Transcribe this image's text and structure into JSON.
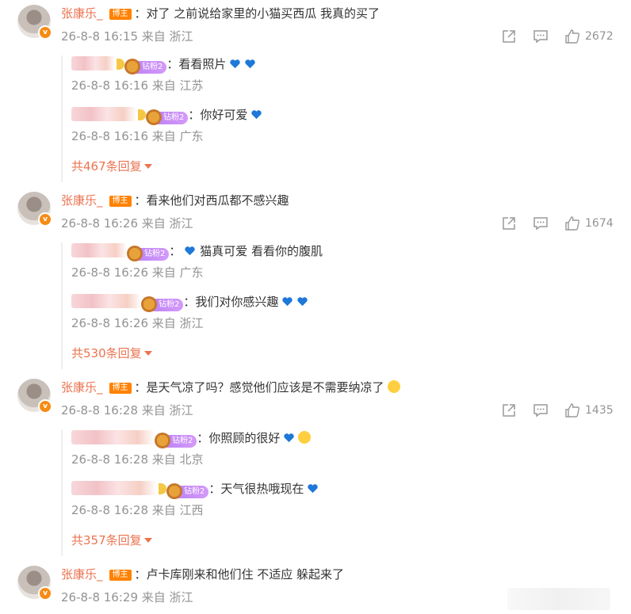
{
  "comments": [
    {
      "user": "张康乐_",
      "badge": "博主",
      "text": "：对了 之前说给家里的小猫买西瓜 我真的买了",
      "meta": "26-8-8 16:15 来自 浙江",
      "likes": "2672",
      "replies": [
        {
          "fan": "钻粉2",
          "text": "：看看照片",
          "hearts": 2,
          "meta": "26-8-8 16:16 来自 江苏"
        },
        {
          "fan": "钻粉2",
          "text": "：你好可爱",
          "hearts": 1,
          "meta": "26-8-8 16:16 来自 广东"
        }
      ],
      "more": "共467条回复"
    },
    {
      "user": "张康乐_",
      "badge": "博主",
      "text": "：看来他们对西瓜都不感兴趣",
      "meta": "26-8-8 16:26 来自 浙江",
      "likes": "1674",
      "replies": [
        {
          "fan": "钻粉2",
          "text": "猫真可爱 看看你的腹肌",
          "prefix": "：",
          "meta": "26-8-8 16:26 来自 广东"
        },
        {
          "fan": "钻粉2",
          "text": "：我们对你感兴趣",
          "hearts": 2,
          "meta": "26-8-8 16:26 来自 浙江"
        }
      ],
      "more": "共530条回复"
    },
    {
      "user": "张康乐_",
      "badge": "博主",
      "text": "：是天气凉了吗？感觉他们应该是不需要纳凉了",
      "meta": "26-8-8 16:28 来自 浙江",
      "likes": "1435",
      "replies": [
        {
          "fan": "钻粉2",
          "text": "：你照顾的很好",
          "hearts": 1,
          "meta": "26-8-8 16:28 来自 北京"
        },
        {
          "fan": "钻粉2",
          "text": "：天气很热哦现在",
          "hearts": 1,
          "meta": "26-8-8 16:28 来自 江西"
        }
      ],
      "more": "共357条回复"
    },
    {
      "user": "张康乐_",
      "badge": "博主",
      "text": "：卢卡库刚来和他们住 不适应 躲起来了",
      "meta": "26-8-8 16:29 来自 浙江"
    }
  ],
  "icons": {
    "share": "share-icon",
    "comment": "comment-icon",
    "like": "thumbs-up-icon",
    "heart": "blue-heart-icon"
  },
  "colors": {
    "username": "#eb7350",
    "badge": "#ff8200",
    "fan_badge": "#b77cf6",
    "meta": "#939393",
    "heart": "#1e78d8"
  }
}
